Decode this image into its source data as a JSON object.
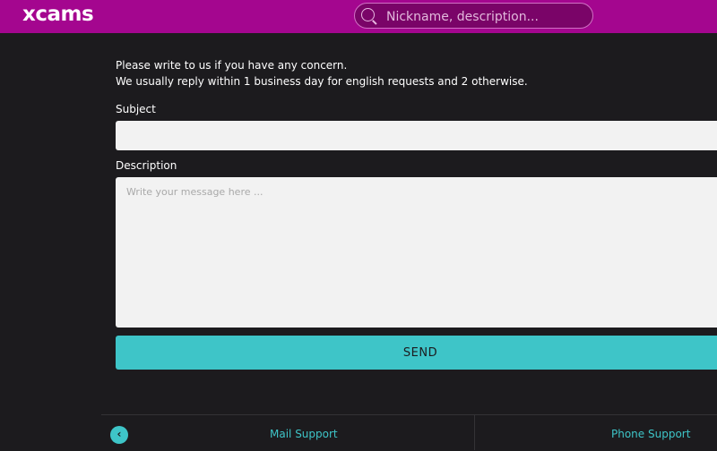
{
  "header": {
    "logo": "xcams",
    "search_placeholder": "Nickname, description...",
    "colors": {
      "bar": "#a4068f",
      "accent": "#3ec5c8"
    }
  },
  "intro": {
    "line1": "Please write to us if you have any concern.",
    "line2": "We usually reply within 1 business day for english requests and 2 otherwise."
  },
  "form": {
    "subject_label": "Subject",
    "subject_value": "",
    "description_label": "Description",
    "description_placeholder": "Write your message here ...",
    "send_label": "SEND"
  },
  "footer": {
    "back_icon": "chevron-left-icon",
    "back_glyph": "‹",
    "mail_support": "Mail Support",
    "phone_support": "Phone Support"
  }
}
